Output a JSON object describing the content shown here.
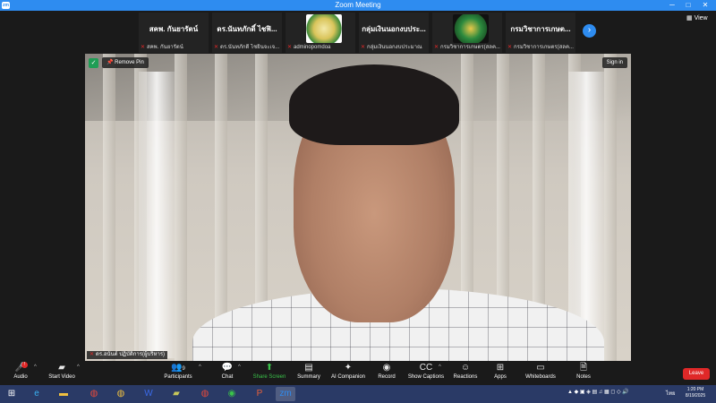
{
  "window": {
    "title": "Zoom Meeting",
    "app_icon_text": "zm",
    "minimize": "─",
    "maximize": "□",
    "close": "✕"
  },
  "top_strip": {
    "view_label": "View",
    "thumbs": [
      {
        "big": "สคพ. กันยารัตน์",
        "caption": "สคพ. กันยารัตน์",
        "has_logo": false
      },
      {
        "big": "ดร.นันทภักดิ์ ไชฟิ...",
        "caption": "ดร.นันทภักดิ์ ไชยินจะเจ...",
        "has_logo": false
      },
      {
        "big": "",
        "caption": "adminopomdoa",
        "has_logo": true,
        "logo_color": "#d9c45a"
      },
      {
        "big": "กลุ่มเงินนอกงบประ...",
        "caption": "กลุ่มเงินนอกงบประมาณ",
        "has_logo": false
      },
      {
        "big": "",
        "caption": "กรมวิชาการเกษตร(สลค...",
        "has_logo": true,
        "logo_color": "#1e7b34"
      },
      {
        "big": "กรมวิชาการเกษต...",
        "caption": "กรมวิชาการเกษตร(สลค...",
        "has_logo": false
      }
    ]
  },
  "video": {
    "remove_pin": "Remove Pin",
    "sign_in": "Sign in",
    "name_tag": "ดร.อนันต์ ปฏิบัติการ(ผู้บริหาร)"
  },
  "toolbar": {
    "audio": "Audio",
    "start_video": "Start Video",
    "participants": "Participants",
    "participants_count": "9",
    "chat": "Chat",
    "share_screen": "Share Screen",
    "summary": "Summary",
    "ai_companion": "AI Companion",
    "record": "Record",
    "show_captions": "Show Captions",
    "reactions": "Reactions",
    "apps": "Apps",
    "whiteboards": "Whiteboards",
    "notes": "Notes",
    "leave": "Leave"
  },
  "taskbar": {
    "lang": "ไทย",
    "time": "1:20 PM",
    "date": "8/19/2025"
  },
  "colors": {
    "accent": "#2e8cf0",
    "leave": "#e02828",
    "share": "#3ac24a"
  }
}
